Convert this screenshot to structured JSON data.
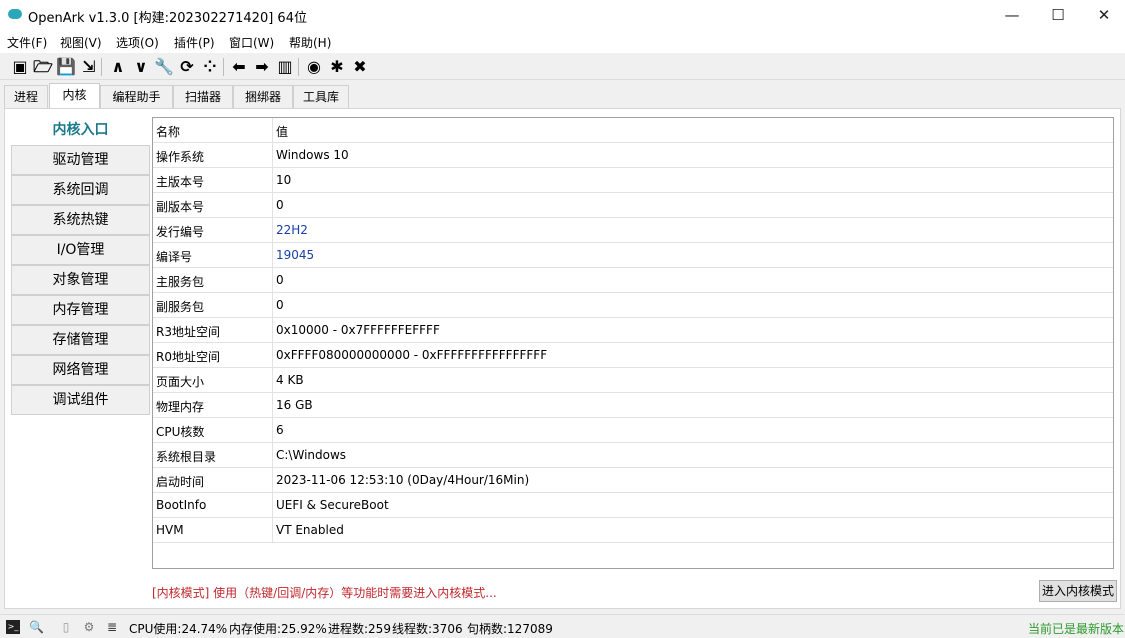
{
  "window": {
    "title": "OpenArk v1.3.0 [构建:202302271420]  64位",
    "minimize": "—",
    "maximize": "☐",
    "close": "✕"
  },
  "menu": [
    "文件(F)",
    "视图(V)",
    "选项(O)",
    "插件(P)",
    "窗口(W)",
    "帮助(H)"
  ],
  "toolbar": [
    {
      "name": "console-icon",
      "glyph": "▣"
    },
    {
      "name": "open-folder-icon",
      "glyph": "🗁"
    },
    {
      "name": "save-icon",
      "glyph": "💾"
    },
    {
      "name": "export-icon",
      "glyph": "⇲"
    },
    {
      "name": "chevron-up-icon",
      "glyph": "∧"
    },
    {
      "name": "chevron-down-icon",
      "glyph": "∨"
    },
    {
      "name": "wrench-icon",
      "glyph": "🔧"
    },
    {
      "name": "refresh-icon",
      "glyph": "⟳"
    },
    {
      "name": "grid-icon",
      "glyph": "⁘"
    },
    {
      "name": "arrow-left-icon",
      "glyph": "⬅"
    },
    {
      "name": "arrow-right-icon",
      "glyph": "➡"
    },
    {
      "name": "map-icon",
      "glyph": "▥"
    },
    {
      "name": "github-icon",
      "glyph": "◉"
    },
    {
      "name": "pin-icon",
      "glyph": "✱"
    },
    {
      "name": "close-box-icon",
      "glyph": "✖"
    }
  ],
  "tabs": [
    "进程",
    "内核",
    "编程助手",
    "扫描器",
    "捆绑器",
    "工具库"
  ],
  "active_tab": 1,
  "sidebar": [
    "内核入口",
    "驱动管理",
    "系统回调",
    "系统热键",
    "I/O管理",
    "对象管理",
    "内存管理",
    "存储管理",
    "网络管理",
    "调试组件"
  ],
  "table": {
    "headers": [
      "名称",
      "值"
    ],
    "rows": [
      [
        "操作系统",
        "Windows 10"
      ],
      [
        "主版本号",
        "10"
      ],
      [
        "副版本号",
        "0"
      ],
      [
        "发行编号",
        "22H2"
      ],
      [
        "编译号",
        "19045"
      ],
      [
        "主服务包",
        "0"
      ],
      [
        "副服务包",
        "0"
      ],
      [
        "R3地址空间",
        "0x10000 - 0x7FFFFFFEFFFF"
      ],
      [
        "R0地址空间",
        "0xFFFF080000000000 - 0xFFFFFFFFFFFFFFFF"
      ],
      [
        "页面大小",
        "4 KB"
      ],
      [
        "物理内存",
        "16 GB"
      ],
      [
        "CPU核数",
        "6"
      ],
      [
        "系统根目录",
        "C:\\Windows"
      ],
      [
        "启动时间",
        "2023-11-06 12:53:10 (0Day/4Hour/16Min)"
      ],
      [
        "BootInfo",
        "UEFI & SecureBoot"
      ],
      [
        "HVM",
        "VT Enabled"
      ]
    ]
  },
  "hint": "[内核模式] 使用（热键/回调/内存）等功能时需要进入内核模式...",
  "enter_kernel_button": "进入内核模式",
  "status": {
    "cpu": "CPU使用:24.74%",
    "mem": "内存使用:25.92%",
    "procs": "进程数:259",
    "threads": "线程数:3706",
    "handles": "句柄数:127089",
    "version": "当前已是最新版本"
  },
  "colors": {
    "accent": "#1a7a8a",
    "hint": "#c0282d",
    "version": "#2e9a2e",
    "link": "#1a3fa8"
  }
}
